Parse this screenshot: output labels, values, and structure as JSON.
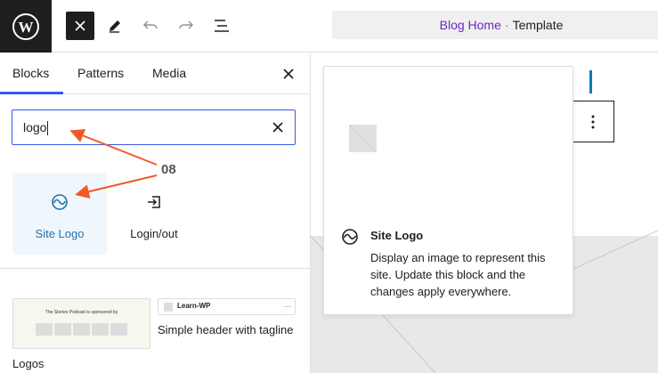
{
  "topbar": {
    "logo_icon": "wordpress-icon",
    "tools": [
      "close-icon",
      "pencil-icon",
      "undo-icon",
      "redo-icon",
      "list-view-icon"
    ],
    "command_center": {
      "page": "Blog Home",
      "separator": "·",
      "type": "Template"
    }
  },
  "inserter": {
    "tabs": [
      "Blocks",
      "Patterns",
      "Media"
    ],
    "active_tab": "Blocks",
    "search": {
      "value": "logo"
    },
    "blocks": [
      {
        "label": "Site Logo",
        "icon": "site-logo-icon",
        "selected": true
      },
      {
        "label": "Login/out",
        "icon": "login-icon",
        "selected": false
      }
    ],
    "patterns": [
      {
        "label": "Logos",
        "preview_text": "The Stories Podcast is sponsored by"
      },
      {
        "label": "Simple header with tagline",
        "preview_text": "Learn-WP"
      }
    ]
  },
  "preview": {
    "title": "Site Logo",
    "description": "Display an image to represent this site. Update this block and the changes apply everywhere.",
    "icon": "site-logo-icon"
  },
  "annotation": {
    "number": "08",
    "color": "#f05a28"
  },
  "colors": {
    "accent": "#3858e9",
    "highlight": "#007cba",
    "breadcrumb": "#6b28c9"
  }
}
